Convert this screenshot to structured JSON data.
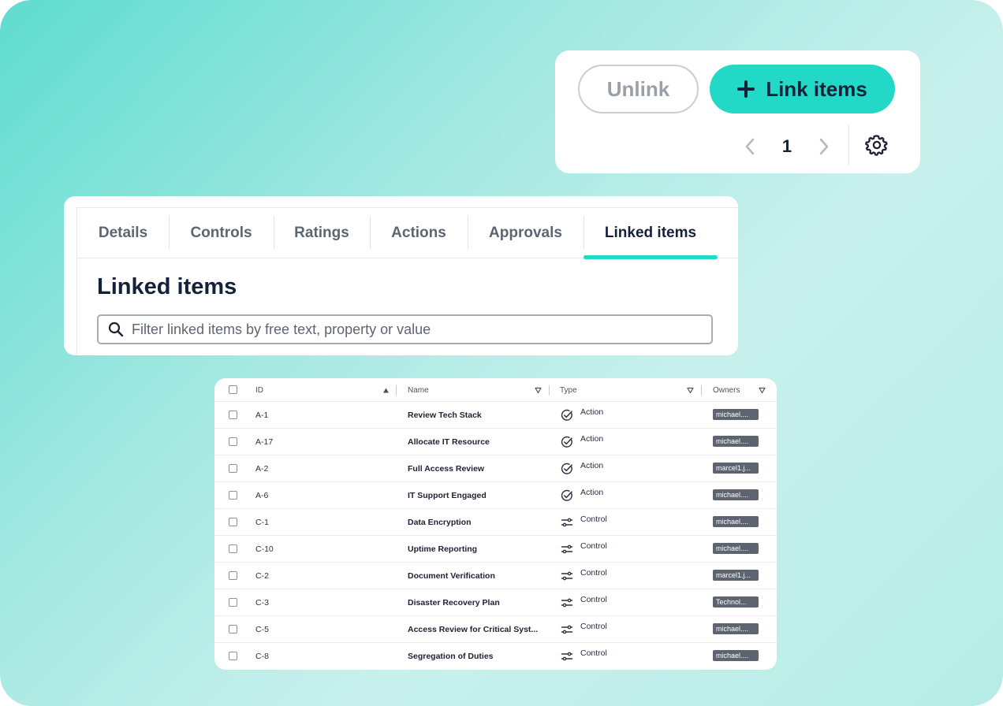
{
  "actions": {
    "unlink_label": "Unlink",
    "link_label": "Link items",
    "page_number": "1"
  },
  "tabs": [
    {
      "label": "Details"
    },
    {
      "label": "Controls"
    },
    {
      "label": "Ratings"
    },
    {
      "label": "Actions"
    },
    {
      "label": "Approvals"
    },
    {
      "label": "Linked items",
      "active": true
    }
  ],
  "section": {
    "title": "Linked items",
    "filter_placeholder": "Filter linked items by free text, property or value"
  },
  "table": {
    "columns": {
      "id": "ID",
      "name": "Name",
      "type": "Type",
      "owners": "Owners"
    },
    "rows": [
      {
        "id": "A-1",
        "name": "Review Tech Stack",
        "type": "Action",
        "owner": "michael...."
      },
      {
        "id": "A-17",
        "name": "Allocate IT Resource",
        "type": "Action",
        "owner": "michael...."
      },
      {
        "id": "A-2",
        "name": "Full Access Review",
        "type": "Action",
        "owner": "marcel1.j..."
      },
      {
        "id": "A-6",
        "name": "IT Support Engaged",
        "type": "Action",
        "owner": "michael...."
      },
      {
        "id": "C-1",
        "name": "Data Encryption",
        "type": "Control",
        "owner": "michael...."
      },
      {
        "id": "C-10",
        "name": "Uptime Reporting",
        "type": "Control",
        "owner": "michael...."
      },
      {
        "id": "C-2",
        "name": "Document Verification",
        "type": "Control",
        "owner": "marcel1.j..."
      },
      {
        "id": "C-3",
        "name": "Disaster Recovery Plan",
        "type": "Control",
        "owner": "Technol..."
      },
      {
        "id": "C-5",
        "name": "Access Review for Critical Syst...",
        "type": "Control",
        "owner": "michael...."
      },
      {
        "id": "C-8",
        "name": "Segregation of Duties",
        "type": "Control",
        "owner": "michael...."
      }
    ]
  },
  "colors": {
    "accent": "#22d8c6",
    "text": "#14213a",
    "owner_badge": "#5d6470"
  }
}
